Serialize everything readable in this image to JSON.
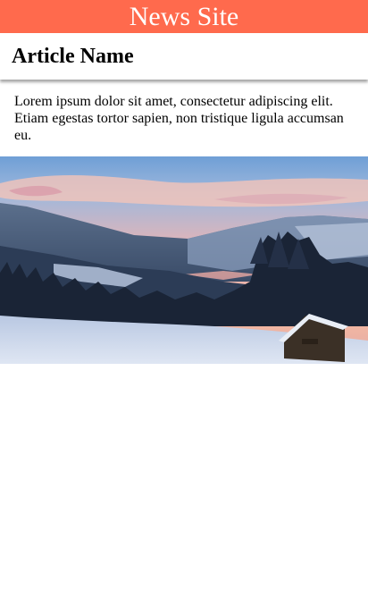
{
  "header": {
    "site_name": "News Site",
    "background_color": "#ff6a4d"
  },
  "article": {
    "title": "Article Name",
    "body": "Lorem ipsum dolor sit amet, consectetur adipiscing elit. Etiam egestas tortor sapien, non tristique ligula accumsan eu."
  }
}
